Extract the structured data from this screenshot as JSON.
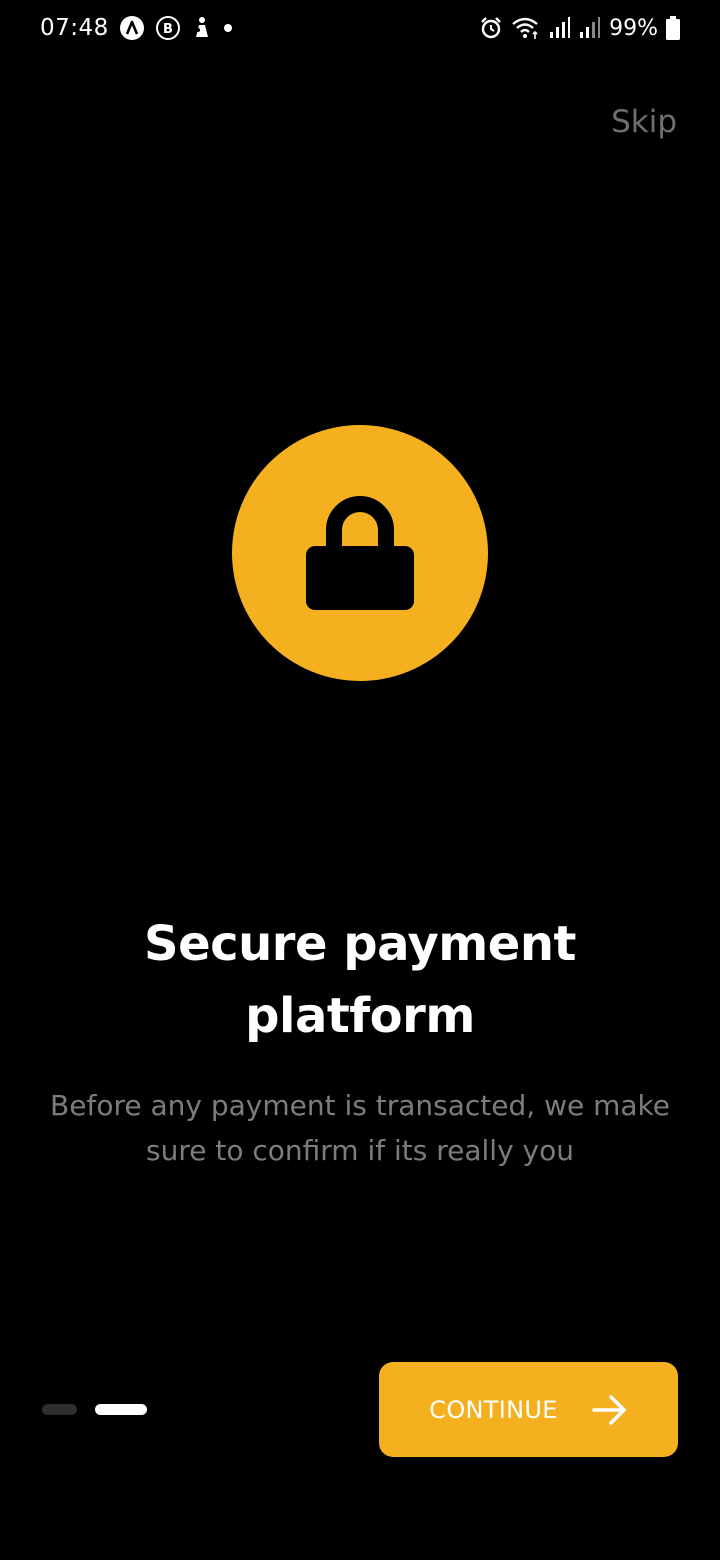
{
  "status_bar": {
    "time": "07:48",
    "battery_percent": "99%",
    "left_icons": [
      "a-circle-icon",
      "b-circle-icon",
      "app-notification-icon",
      "dot-icon"
    ],
    "right_icons": [
      "alarm-icon",
      "wifi-icon",
      "signal-icon",
      "signal-icon",
      "battery-icon"
    ]
  },
  "header": {
    "skip_label": "Skip"
  },
  "hero": {
    "icon": "lock-icon",
    "circle_color": "#f5b020"
  },
  "content": {
    "title": "Secure payment platform",
    "description": "Before any payment is transacted, we make sure to confirm if its really you"
  },
  "pager": {
    "total_pages": 2,
    "current_page": 2
  },
  "footer": {
    "continue_label": "CONTINUE",
    "continue_icon": "arrow-right-icon",
    "accent_color": "#f5b020"
  }
}
